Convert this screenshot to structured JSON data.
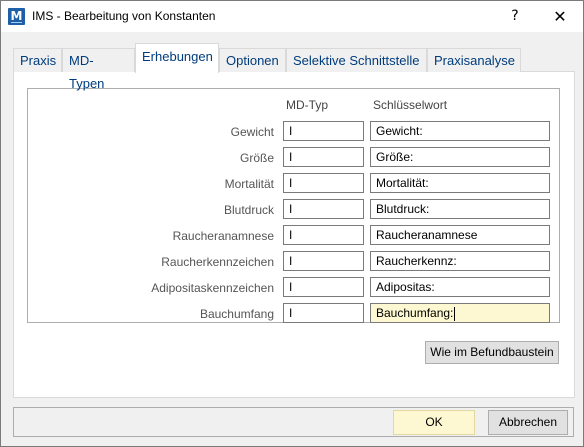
{
  "window": {
    "app_icon": "ims-logo-icon",
    "app_icon_letter": "M",
    "title": "IMS - Bearbeitung von Konstanten",
    "help_symbol": "?",
    "close_symbol": "✕"
  },
  "tabs": [
    {
      "label": "Praxis"
    },
    {
      "label": "MD-Typen"
    },
    {
      "label": "Erhebungen",
      "active": true
    },
    {
      "label": "Optionen"
    },
    {
      "label": "Selektive Schnittstelle"
    },
    {
      "label": "Praxisanalyse"
    }
  ],
  "columns": {
    "md_typ": "MD-Typ",
    "schluesselwort": "Schlüsselwort"
  },
  "rows": [
    {
      "label": "Gewicht",
      "md_typ": "I",
      "key": "Gewicht:"
    },
    {
      "label": "Größe",
      "md_typ": "I",
      "key": "Größe:"
    },
    {
      "label": "Mortalität",
      "md_typ": "I",
      "key": "Mortalität:"
    },
    {
      "label": "Blutdruck",
      "md_typ": "I",
      "key": "Blutdruck:"
    },
    {
      "label": "Raucheranamnese",
      "md_typ": "I",
      "key": "Raucheranamnese"
    },
    {
      "label": "Raucherkennzeichen",
      "md_typ": "I",
      "key": "Raucherkennz:"
    },
    {
      "label": "Adipositaskennzeichen",
      "md_typ": "I",
      "key": "Adipositas:"
    },
    {
      "label": "Bauchumfang",
      "md_typ": "I",
      "key": "Bauchumfang:"
    }
  ],
  "buttons": {
    "befund": "Wie im Befundbaustein",
    "ok": "OK",
    "cancel": "Abbrechen"
  },
  "colors": {
    "focus_field": "#fdf8d1",
    "tab_text": "#003c7d"
  }
}
